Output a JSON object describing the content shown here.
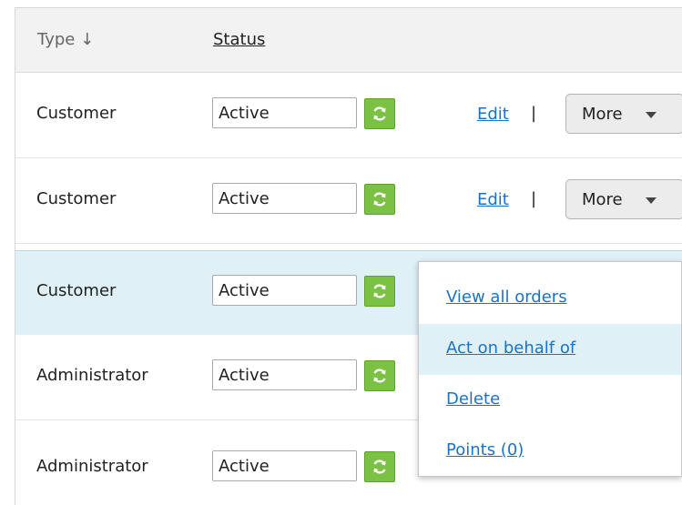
{
  "header": {
    "type_label": "Type ↓",
    "status_label": "Status"
  },
  "rows": [
    {
      "type": "Customer",
      "status": "Active",
      "edit": "Edit",
      "separator": "|",
      "more": "More"
    },
    {
      "type": "Customer",
      "status": "Active",
      "edit": "Edit",
      "separator": "|",
      "more": "More"
    },
    {
      "type": "Customer",
      "status": "Active"
    },
    {
      "type": "Administrator",
      "status": "Active"
    },
    {
      "type": "Administrator",
      "status": "Active"
    }
  ],
  "more_menu": {
    "items": [
      "View all orders",
      "Act on behalf of",
      "Delete",
      "Points (0)"
    ]
  },
  "colors": {
    "refresh_button": "#7bc143",
    "link": "#1a73c8",
    "selected_row": "#dff0f6"
  },
  "icons": {
    "refresh": "refresh-icon",
    "sort": "sort-down-arrow",
    "dropdown": "caret-down-icon"
  }
}
